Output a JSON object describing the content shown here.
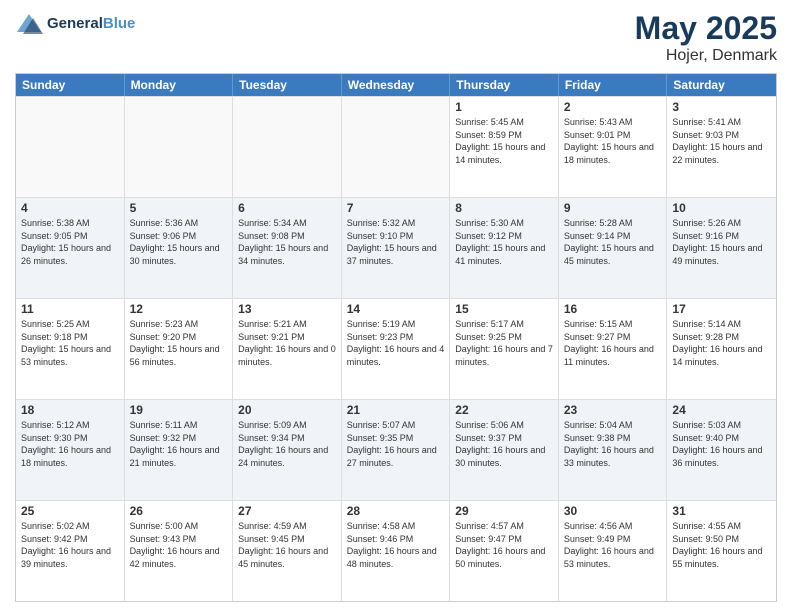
{
  "app": {
    "name_general": "General",
    "name_blue": "Blue",
    "title": "May 2025",
    "subtitle": "Hojer, Denmark"
  },
  "calendar": {
    "headers": [
      "Sunday",
      "Monday",
      "Tuesday",
      "Wednesday",
      "Thursday",
      "Friday",
      "Saturday"
    ],
    "rows": [
      {
        "alt": false,
        "cells": [
          {
            "empty": true,
            "day": "",
            "sunrise": "",
            "sunset": "",
            "daylight": ""
          },
          {
            "empty": true,
            "day": "",
            "sunrise": "",
            "sunset": "",
            "daylight": ""
          },
          {
            "empty": true,
            "day": "",
            "sunrise": "",
            "sunset": "",
            "daylight": ""
          },
          {
            "empty": true,
            "day": "",
            "sunrise": "",
            "sunset": "",
            "daylight": ""
          },
          {
            "empty": false,
            "day": "1",
            "sunrise": "Sunrise: 5:45 AM",
            "sunset": "Sunset: 8:59 PM",
            "daylight": "Daylight: 15 hours and 14 minutes."
          },
          {
            "empty": false,
            "day": "2",
            "sunrise": "Sunrise: 5:43 AM",
            "sunset": "Sunset: 9:01 PM",
            "daylight": "Daylight: 15 hours and 18 minutes."
          },
          {
            "empty": false,
            "day": "3",
            "sunrise": "Sunrise: 5:41 AM",
            "sunset": "Sunset: 9:03 PM",
            "daylight": "Daylight: 15 hours and 22 minutes."
          }
        ]
      },
      {
        "alt": true,
        "cells": [
          {
            "empty": false,
            "day": "4",
            "sunrise": "Sunrise: 5:38 AM",
            "sunset": "Sunset: 9:05 PM",
            "daylight": "Daylight: 15 hours and 26 minutes."
          },
          {
            "empty": false,
            "day": "5",
            "sunrise": "Sunrise: 5:36 AM",
            "sunset": "Sunset: 9:06 PM",
            "daylight": "Daylight: 15 hours and 30 minutes."
          },
          {
            "empty": false,
            "day": "6",
            "sunrise": "Sunrise: 5:34 AM",
            "sunset": "Sunset: 9:08 PM",
            "daylight": "Daylight: 15 hours and 34 minutes."
          },
          {
            "empty": false,
            "day": "7",
            "sunrise": "Sunrise: 5:32 AM",
            "sunset": "Sunset: 9:10 PM",
            "daylight": "Daylight: 15 hours and 37 minutes."
          },
          {
            "empty": false,
            "day": "8",
            "sunrise": "Sunrise: 5:30 AM",
            "sunset": "Sunset: 9:12 PM",
            "daylight": "Daylight: 15 hours and 41 minutes."
          },
          {
            "empty": false,
            "day": "9",
            "sunrise": "Sunrise: 5:28 AM",
            "sunset": "Sunset: 9:14 PM",
            "daylight": "Daylight: 15 hours and 45 minutes."
          },
          {
            "empty": false,
            "day": "10",
            "sunrise": "Sunrise: 5:26 AM",
            "sunset": "Sunset: 9:16 PM",
            "daylight": "Daylight: 15 hours and 49 minutes."
          }
        ]
      },
      {
        "alt": false,
        "cells": [
          {
            "empty": false,
            "day": "11",
            "sunrise": "Sunrise: 5:25 AM",
            "sunset": "Sunset: 9:18 PM",
            "daylight": "Daylight: 15 hours and 53 minutes."
          },
          {
            "empty": false,
            "day": "12",
            "sunrise": "Sunrise: 5:23 AM",
            "sunset": "Sunset: 9:20 PM",
            "daylight": "Daylight: 15 hours and 56 minutes."
          },
          {
            "empty": false,
            "day": "13",
            "sunrise": "Sunrise: 5:21 AM",
            "sunset": "Sunset: 9:21 PM",
            "daylight": "Daylight: 16 hours and 0 minutes."
          },
          {
            "empty": false,
            "day": "14",
            "sunrise": "Sunrise: 5:19 AM",
            "sunset": "Sunset: 9:23 PM",
            "daylight": "Daylight: 16 hours and 4 minutes."
          },
          {
            "empty": false,
            "day": "15",
            "sunrise": "Sunrise: 5:17 AM",
            "sunset": "Sunset: 9:25 PM",
            "daylight": "Daylight: 16 hours and 7 minutes."
          },
          {
            "empty": false,
            "day": "16",
            "sunrise": "Sunrise: 5:15 AM",
            "sunset": "Sunset: 9:27 PM",
            "daylight": "Daylight: 16 hours and 11 minutes."
          },
          {
            "empty": false,
            "day": "17",
            "sunrise": "Sunrise: 5:14 AM",
            "sunset": "Sunset: 9:28 PM",
            "daylight": "Daylight: 16 hours and 14 minutes."
          }
        ]
      },
      {
        "alt": true,
        "cells": [
          {
            "empty": false,
            "day": "18",
            "sunrise": "Sunrise: 5:12 AM",
            "sunset": "Sunset: 9:30 PM",
            "daylight": "Daylight: 16 hours and 18 minutes."
          },
          {
            "empty": false,
            "day": "19",
            "sunrise": "Sunrise: 5:11 AM",
            "sunset": "Sunset: 9:32 PM",
            "daylight": "Daylight: 16 hours and 21 minutes."
          },
          {
            "empty": false,
            "day": "20",
            "sunrise": "Sunrise: 5:09 AM",
            "sunset": "Sunset: 9:34 PM",
            "daylight": "Daylight: 16 hours and 24 minutes."
          },
          {
            "empty": false,
            "day": "21",
            "sunrise": "Sunrise: 5:07 AM",
            "sunset": "Sunset: 9:35 PM",
            "daylight": "Daylight: 16 hours and 27 minutes."
          },
          {
            "empty": false,
            "day": "22",
            "sunrise": "Sunrise: 5:06 AM",
            "sunset": "Sunset: 9:37 PM",
            "daylight": "Daylight: 16 hours and 30 minutes."
          },
          {
            "empty": false,
            "day": "23",
            "sunrise": "Sunrise: 5:04 AM",
            "sunset": "Sunset: 9:38 PM",
            "daylight": "Daylight: 16 hours and 33 minutes."
          },
          {
            "empty": false,
            "day": "24",
            "sunrise": "Sunrise: 5:03 AM",
            "sunset": "Sunset: 9:40 PM",
            "daylight": "Daylight: 16 hours and 36 minutes."
          }
        ]
      },
      {
        "alt": false,
        "cells": [
          {
            "empty": false,
            "day": "25",
            "sunrise": "Sunrise: 5:02 AM",
            "sunset": "Sunset: 9:42 PM",
            "daylight": "Daylight: 16 hours and 39 minutes."
          },
          {
            "empty": false,
            "day": "26",
            "sunrise": "Sunrise: 5:00 AM",
            "sunset": "Sunset: 9:43 PM",
            "daylight": "Daylight: 16 hours and 42 minutes."
          },
          {
            "empty": false,
            "day": "27",
            "sunrise": "Sunrise: 4:59 AM",
            "sunset": "Sunset: 9:45 PM",
            "daylight": "Daylight: 16 hours and 45 minutes."
          },
          {
            "empty": false,
            "day": "28",
            "sunrise": "Sunrise: 4:58 AM",
            "sunset": "Sunset: 9:46 PM",
            "daylight": "Daylight: 16 hours and 48 minutes."
          },
          {
            "empty": false,
            "day": "29",
            "sunrise": "Sunrise: 4:57 AM",
            "sunset": "Sunset: 9:47 PM",
            "daylight": "Daylight: 16 hours and 50 minutes."
          },
          {
            "empty": false,
            "day": "30",
            "sunrise": "Sunrise: 4:56 AM",
            "sunset": "Sunset: 9:49 PM",
            "daylight": "Daylight: 16 hours and 53 minutes."
          },
          {
            "empty": false,
            "day": "31",
            "sunrise": "Sunrise: 4:55 AM",
            "sunset": "Sunset: 9:50 PM",
            "daylight": "Daylight: 16 hours and 55 minutes."
          }
        ]
      }
    ]
  }
}
